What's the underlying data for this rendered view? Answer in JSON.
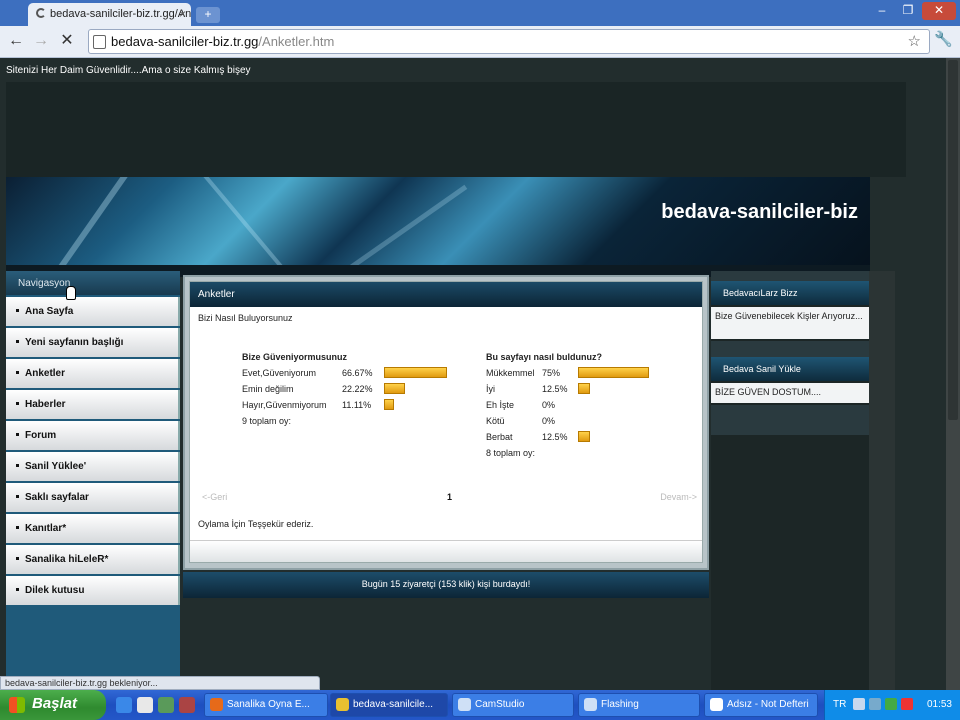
{
  "browser": {
    "tab_title": "bedava-sanilciler-biz.tr.gg/Anl",
    "tab_close": "×",
    "url_host": "bedava-sanilciler-biz.tr.gg",
    "url_path": "/Anketler.htm",
    "status_text": "bedava-sanilciler-biz.tr.gg bekleniyor..."
  },
  "site": {
    "top_note": "Sitenizi Her Daim Güvenlidir....Ama o size Kalmış bişey",
    "title": "bedava-sanilciler-biz"
  },
  "nav": {
    "heading": "Navigasyon",
    "items": [
      {
        "label": "Ana Sayfa"
      },
      {
        "label": "Yeni sayfanın başlığı"
      },
      {
        "label": "Anketler"
      },
      {
        "label": "Haberler"
      },
      {
        "label": "Forum"
      },
      {
        "label": "Sanil Yüklee'"
      },
      {
        "label": "Saklı sayfalar"
      },
      {
        "label": "Kanıtlar*"
      },
      {
        "label": "Sanalika hiLeleR*"
      },
      {
        "label": "Dilek kutusu"
      }
    ]
  },
  "panel": {
    "title": "Anketler",
    "subtitle": "Bizi Nasıl Buluyorsunuz",
    "pager": {
      "prev": "<-Geri",
      "page": "1",
      "next": "Devam->"
    },
    "thanks": "Oylama İçin Teşşekür ederiz."
  },
  "polls": [
    {
      "question": "Bize Güveniyormusunuz",
      "options": [
        {
          "label": "Evet,Güveniyorum",
          "percent": "66.67%",
          "value": 66.67
        },
        {
          "label": "Emin değilim",
          "percent": "22.22%",
          "value": 22.22
        },
        {
          "label": "Hayır,Güvenmiyorum",
          "percent": "11.11%",
          "value": 11.11
        }
      ],
      "total": "9 toplam oy:"
    },
    {
      "question": "Bu sayfayı nasıl buldunuz?",
      "options": [
        {
          "label": "Mükkemmel",
          "percent": "75%",
          "value": 75
        },
        {
          "label": "İyi",
          "percent": "12.5%",
          "value": 12.5
        },
        {
          "label": "Eh İşte",
          "percent": "0%",
          "value": 0
        },
        {
          "label": "Kötü",
          "percent": "0%",
          "value": 0
        },
        {
          "label": "Berbat",
          "percent": "12.5%",
          "value": 12.5
        }
      ],
      "total": "8 toplam oy:"
    }
  ],
  "visits": "Bugün 15 ziyaretçi (153 klik) kişi burdaydı!",
  "right": {
    "box1_title": "BedavacıLarz Bizz",
    "box1_text": "Bize Güvenebilecek Kişler Arıyoruz...",
    "box2_title": "Bedava Sanil Yükle",
    "box2_text": "BİZE GÜVEN DOSTUM...."
  },
  "taskbar": {
    "start": "Başlat",
    "buttons": [
      {
        "label": "Sanalika Oyna E..."
      },
      {
        "label": "bedava-sanilcile..."
      },
      {
        "label": "CamStudio"
      },
      {
        "label": "Flashing"
      },
      {
        "label": "Adsız - Not Defteri"
      }
    ],
    "lang": "TR",
    "clock": "01:53"
  },
  "colors": {
    "accent": "#1b4a66",
    "bar": "#f0b020"
  }
}
